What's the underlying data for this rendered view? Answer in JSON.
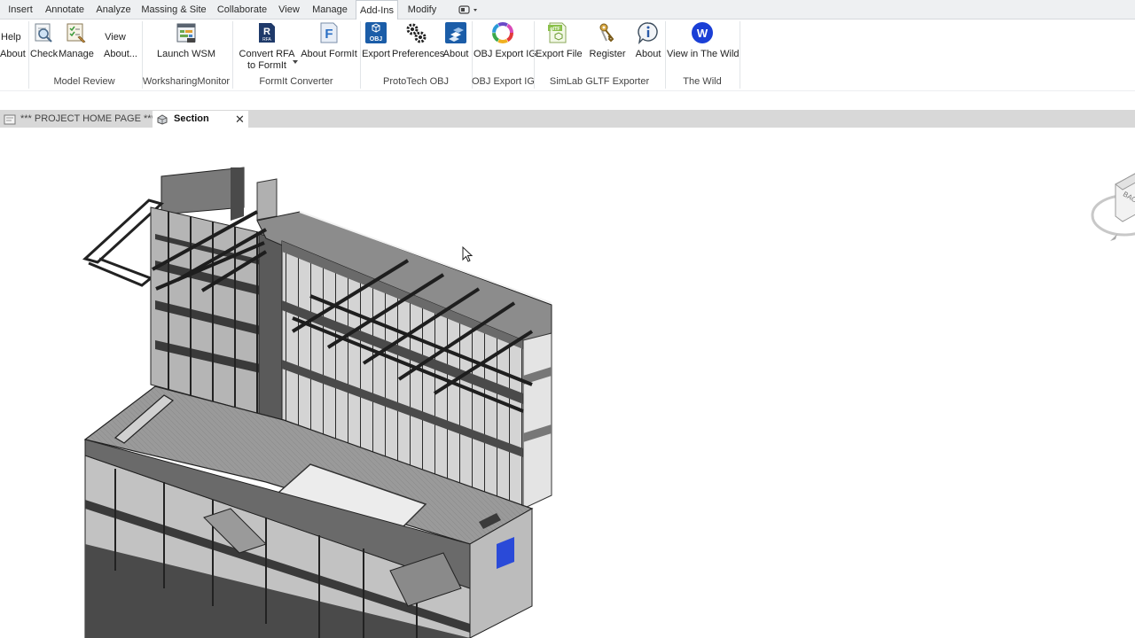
{
  "menu_tabs": [
    "Insert",
    "Annotate",
    "Analyze",
    "Massing & Site",
    "Collaborate",
    "View",
    "Manage",
    "Add-Ins",
    "Modify"
  ],
  "ribbon": {
    "buttons": {
      "help": "Help",
      "about_left": "About",
      "check": "Check",
      "manage": "Manage",
      "view": "View",
      "about_dots": "About...",
      "launch_wsm": "Launch WSM",
      "convert_rfa_line1": "Convert RFA",
      "convert_rfa_line2": "to FormIt",
      "about_formit": "About FormIt",
      "export": "Export",
      "preferences": "Preferences",
      "about_protech": "About",
      "obj_export_ig": "OBJ Export IG",
      "export_file": "Export File",
      "register": "Register",
      "about_wild_info": "About",
      "view_in_wild": "View in The Wild"
    },
    "groups": {
      "model_review": "Model Review",
      "worksharing_monitor": "WorksharingMonitor",
      "formit_converter": "FormIt Converter",
      "protech_obj": "ProtoTech OBJ",
      "obj_export_ig": "OBJ Export IG",
      "simlab_gltf": "SimLab GLTF Exporter",
      "the_wild": "The Wild"
    },
    "icon_letters": {
      "rfa": "RFA",
      "formit": "F",
      "obj": "OBJ",
      "wild": "W",
      "gltf": "glTF"
    }
  },
  "document_tabs": [
    {
      "label": "*** PROJECT HOME PAGE ***",
      "active": false
    },
    {
      "label": "Section",
      "active": true
    }
  ],
  "viewcube": {
    "face_label": "BAC"
  },
  "colors": {
    "tabbar_bg": "#eef0f2",
    "doctab_bg": "#d8d8d8",
    "wild_blue": "#1a3fd6",
    "protech_blue": "#1b5da8",
    "formit_blue": "#2a6fc4"
  }
}
